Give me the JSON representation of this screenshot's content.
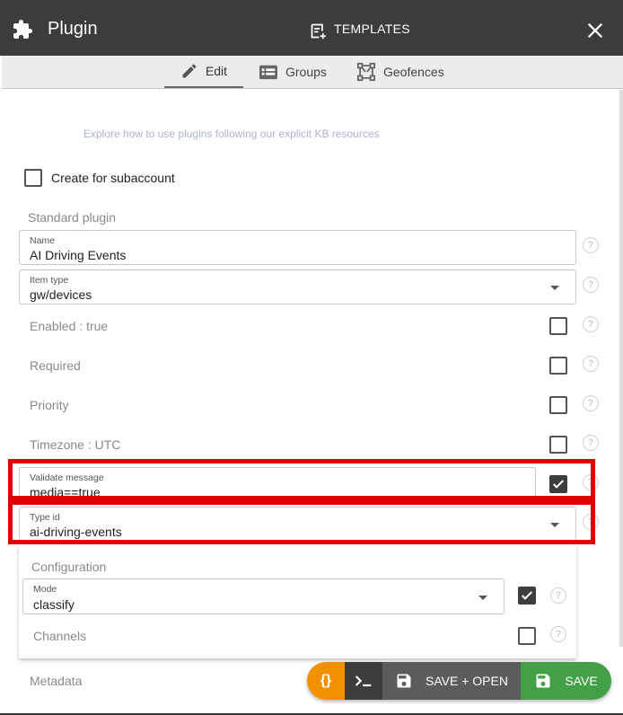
{
  "header": {
    "title": "Plugin",
    "templates_label": "TEMPLATES"
  },
  "tabs": [
    {
      "label": "Edit",
      "icon": "pencil-icon",
      "active": true
    },
    {
      "label": "Groups",
      "icon": "groups-icon",
      "active": false
    },
    {
      "label": "Geofences",
      "icon": "geofence-icon",
      "active": false
    }
  ],
  "hint": "Explore how to use plugins following our explicit KB resources",
  "create_subaccount": {
    "label": "Create for subaccount",
    "checked": false
  },
  "section_title": "Standard plugin",
  "name_field": {
    "label": "Name",
    "value": "AI Driving Events"
  },
  "item_type_field": {
    "label": "Item type",
    "value": "gw/devices"
  },
  "enabled": {
    "label": "Enabled : true",
    "checked": false
  },
  "required": {
    "label": "Required",
    "checked": false
  },
  "priority": {
    "label": "Priority",
    "checked": false
  },
  "timezone": {
    "label": "Timezone : UTC",
    "checked": false
  },
  "validate_field": {
    "label": "Validate message",
    "value": "media==true",
    "checked": true
  },
  "type_id_field": {
    "label": "Type id",
    "value": "ai-driving-events"
  },
  "configuration": {
    "title": "Configuration",
    "mode_field": {
      "label": "Mode",
      "value": "classify",
      "checked": true
    },
    "channels": {
      "label": "Channels",
      "checked": false
    }
  },
  "metadata_label": "Metadata",
  "actions": {
    "json_label": "{}",
    "save_open_label": "SAVE + OPEN",
    "save_label": "SAVE"
  },
  "help_glyph": "?",
  "colors": {
    "titlebar": "#3c3c3c",
    "highlight": "#e00000",
    "json_button": "#f29100",
    "save_button": "#43a047",
    "save_open_button": "#5c5c5c"
  }
}
